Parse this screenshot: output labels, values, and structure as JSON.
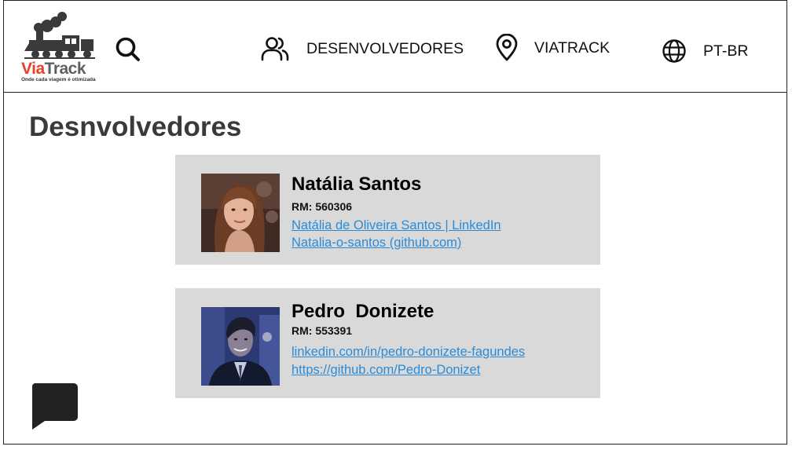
{
  "header": {
    "logo": {
      "word_part1": "Via",
      "word_part2": "Track",
      "tagline": "Onde cada viagem é otimizada",
      "icon": "train-icon"
    },
    "search_icon": "search-icon",
    "nav": [
      {
        "label": "DESENVOLVEDORES",
        "icon": "users-icon"
      },
      {
        "label": "VIATRACK",
        "icon": "map-pin-icon"
      },
      {
        "label": "PT-BR",
        "icon": "globe-icon"
      }
    ]
  },
  "main": {
    "title": "Desnvolvedores",
    "developers": [
      {
        "name": "Natália Santos",
        "rm": "RM: 560306",
        "link1": "Natália de Oliveira Santos | LinkedIn",
        "link2": "Natalia-o-santos (github.com)",
        "photo": "profile-photo"
      },
      {
        "name": "Pedro  Donizete",
        "rm": "RM: 553391",
        "link1": "linkedin.com/in/pedro-donizete-fagundes",
        "link2": "https://github.com/Pedro-Donizet",
        "photo": "profile-photo"
      }
    ]
  },
  "chat": {
    "icon": "chat-bubble-icon"
  },
  "colors": {
    "card_bg": "#d9d9d9",
    "link": "#2b8bd6",
    "title": "#3a3a3a",
    "logo_red": "#e8412b",
    "logo_gray": "#5f5f5f",
    "chat": "#222222"
  }
}
